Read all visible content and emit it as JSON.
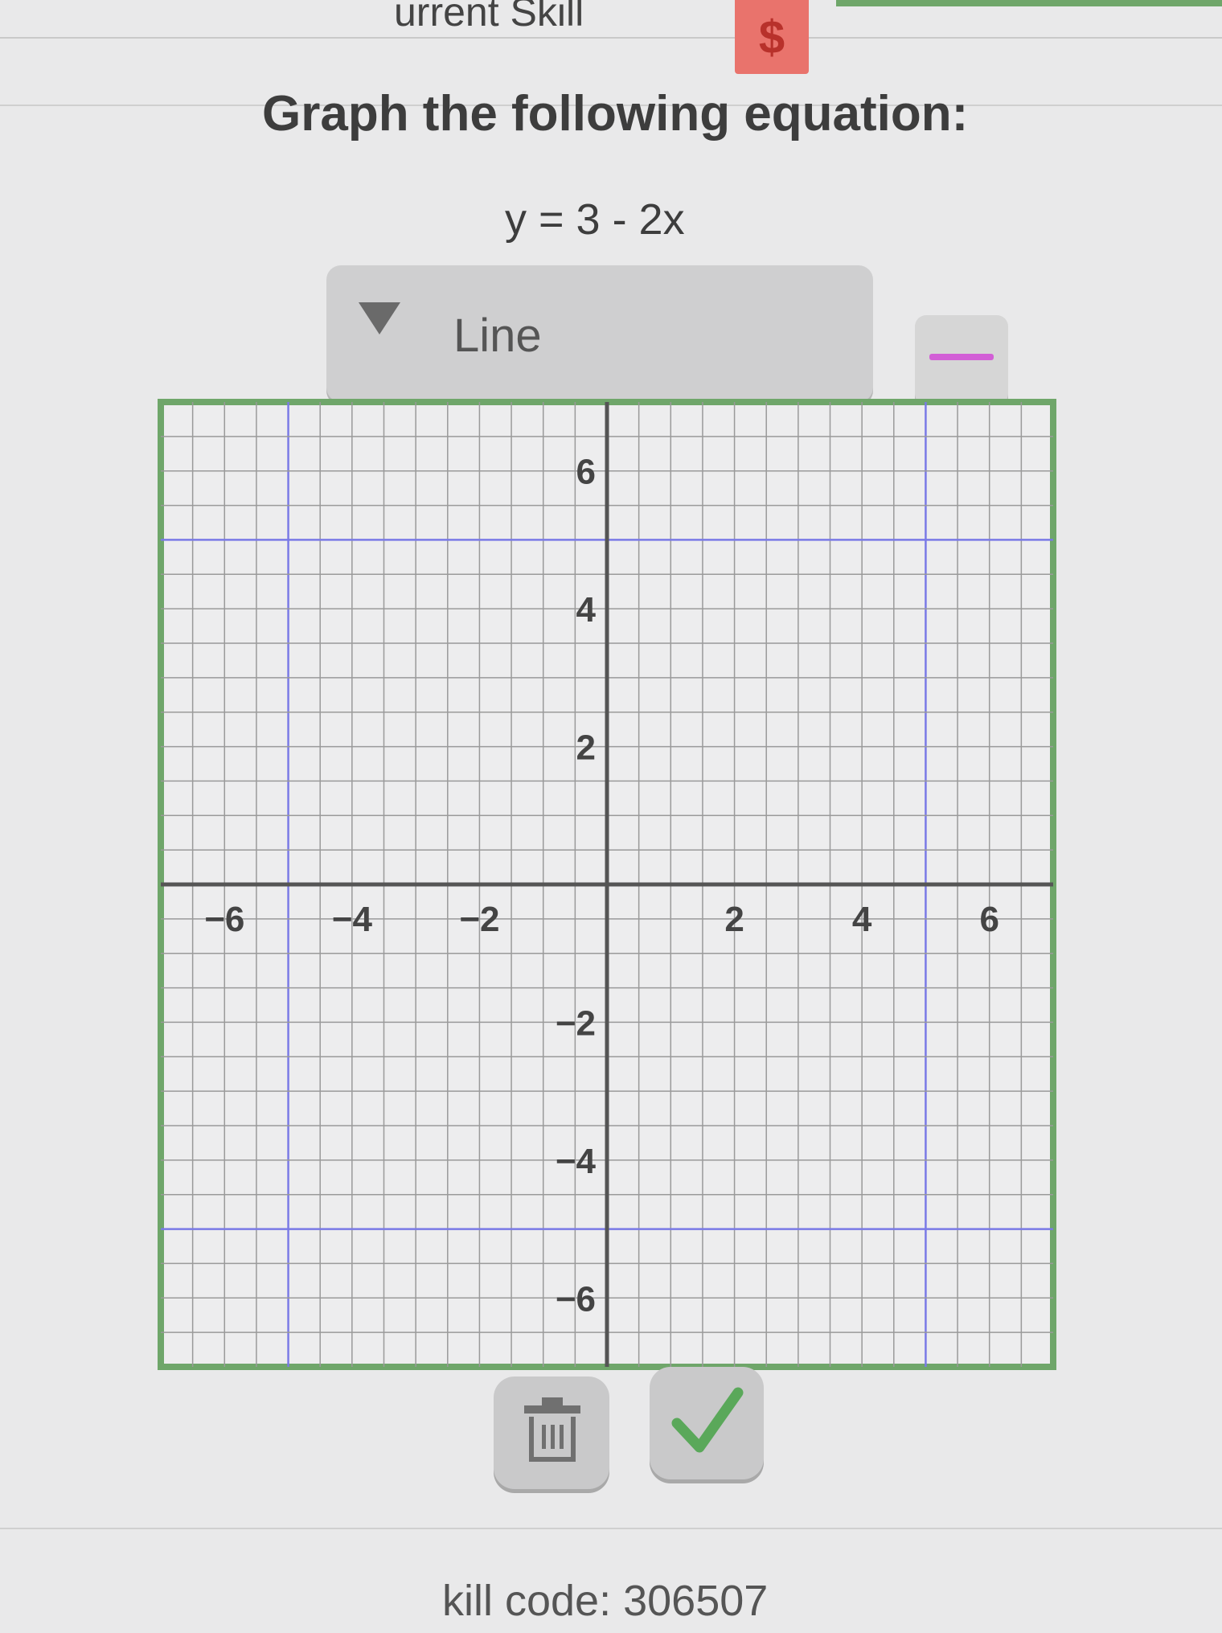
{
  "header": {
    "title": "urrent Skill",
    "coin_icon": "$"
  },
  "question": {
    "prompt": "Graph the following equation:",
    "equation": "y = 3 - 2x"
  },
  "tool_select": {
    "selected": "Line"
  },
  "graph": {
    "x_range": [
      -7,
      7
    ],
    "y_range": [
      -7,
      7
    ],
    "x_tick_labels": [
      "−6",
      "−4",
      "−2",
      "2",
      "4",
      "6"
    ],
    "y_tick_labels": [
      "6",
      "4",
      "2",
      "−2",
      "−4",
      "−6"
    ],
    "x_tick_values": [
      -6,
      -4,
      -2,
      2,
      4,
      6
    ],
    "y_tick_values": [
      6,
      4,
      2,
      -2,
      -4,
      -6
    ],
    "frame_color": "#6fa66a",
    "grid_color": "#9a9a9a",
    "major_grid_color": "#7a7ae6"
  },
  "actions": {
    "trash_icon": "trash-icon",
    "check_icon": "check-icon",
    "check_color": "#5aa85a"
  },
  "footer": {
    "skill_code": "kill code: 306507"
  }
}
